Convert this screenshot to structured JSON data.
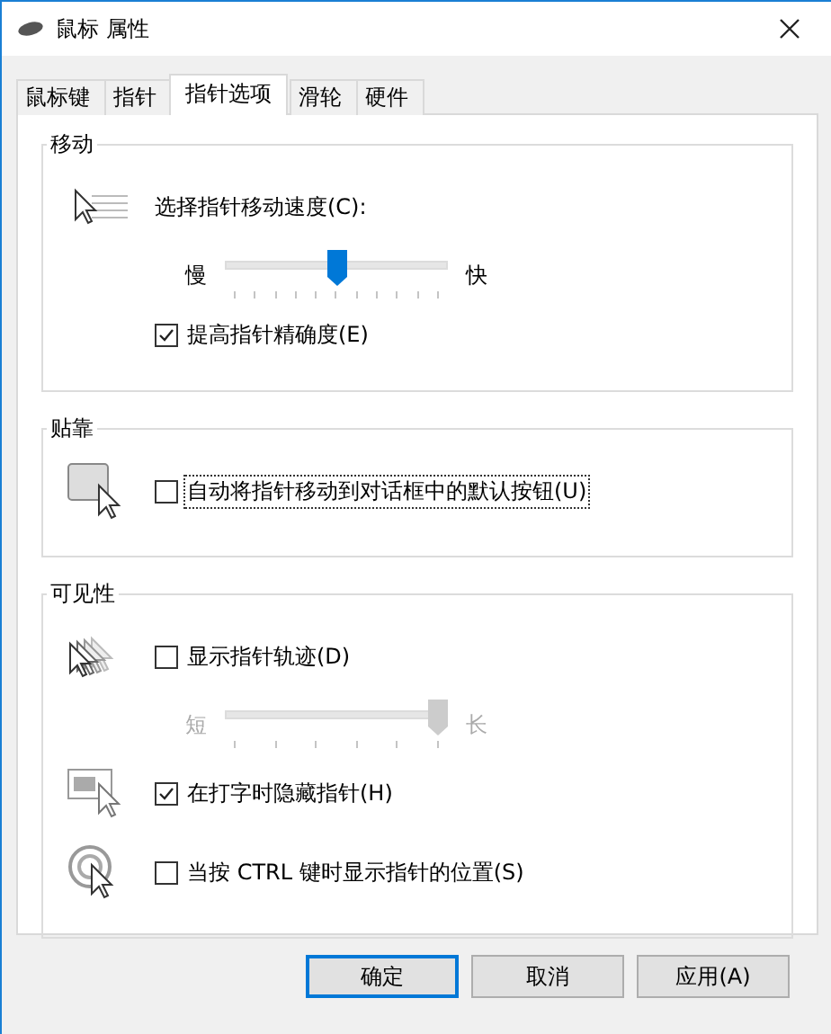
{
  "window": {
    "title": "鼠标 属性"
  },
  "tabs": [
    {
      "label": "鼠标键",
      "selected": false
    },
    {
      "label": "指针",
      "selected": false
    },
    {
      "label": "指针选项",
      "selected": true
    },
    {
      "label": "滑轮",
      "selected": false
    },
    {
      "label": "硬件",
      "selected": false
    }
  ],
  "groups": [
    {
      "title": "移动",
      "rows": [
        {
          "kind": "label",
          "text": "选择指针移动速度(C):"
        },
        {
          "kind": "slider",
          "min_label": "慢",
          "max_label": "快",
          "level": 0.5,
          "disabled": false
        },
        {
          "kind": "checkbox",
          "label": "提高指针精确度(E)",
          "checked": true,
          "focused": false
        }
      ]
    },
    {
      "title": "贴靠",
      "rows": [
        {
          "kind": "checkbox",
          "label": "自动将指针移动到对话框中的默认按钮(U)",
          "checked": false,
          "focused": true
        }
      ]
    },
    {
      "title": "可见性",
      "rows": [
        {
          "kind": "checkbox",
          "label": "显示指针轨迹(D)",
          "checked": false,
          "focused": false
        },
        {
          "kind": "slider",
          "min_label": "短",
          "max_label": "长",
          "level": 1,
          "disabled": true
        },
        {
          "kind": "checkbox",
          "label": "在打字时隐藏指针(H)",
          "checked": true,
          "focused": false
        },
        {
          "kind": "checkbox",
          "label": "当按 CTRL 键时显示指针的位置(S)",
          "checked": false,
          "focused": false
        }
      ]
    }
  ],
  "buttons": [
    {
      "label": "确定",
      "default": true
    },
    {
      "label": "取消",
      "default": false
    },
    {
      "label": "应用(A)",
      "default": false
    }
  ]
}
